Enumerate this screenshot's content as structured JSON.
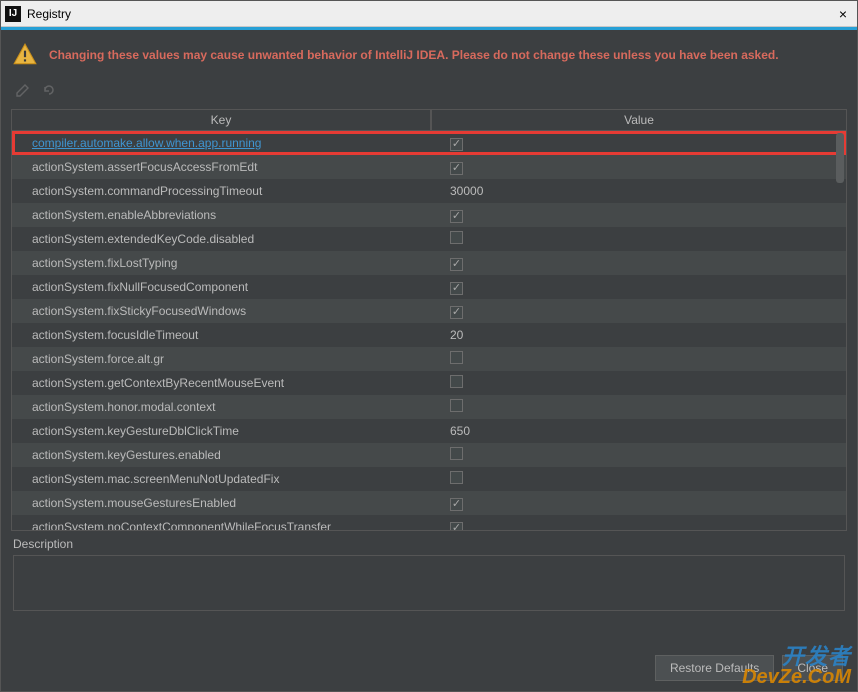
{
  "window": {
    "title": "Registry",
    "close_label": "×"
  },
  "warning": {
    "text": "Changing these values may cause unwanted behavior of IntelliJ IDEA. Please do not change these unless you have been asked."
  },
  "headers": {
    "key": "Key",
    "value": "Value"
  },
  "rows": [
    {
      "key": "compiler.automake.allow.when.app.running",
      "type": "bool",
      "checked": true,
      "highlighted": true
    },
    {
      "key": "actionSystem.assertFocusAccessFromEdt",
      "type": "bool",
      "checked": true
    },
    {
      "key": "actionSystem.commandProcessingTimeout",
      "type": "text",
      "value": "30000"
    },
    {
      "key": "actionSystem.enableAbbreviations",
      "type": "bool",
      "checked": true
    },
    {
      "key": "actionSystem.extendedKeyCode.disabled",
      "type": "bool",
      "checked": false
    },
    {
      "key": "actionSystem.fixLostTyping",
      "type": "bool",
      "checked": true
    },
    {
      "key": "actionSystem.fixNullFocusedComponent",
      "type": "bool",
      "checked": true
    },
    {
      "key": "actionSystem.fixStickyFocusedWindows",
      "type": "bool",
      "checked": true
    },
    {
      "key": "actionSystem.focusIdleTimeout",
      "type": "text",
      "value": "20"
    },
    {
      "key": "actionSystem.force.alt.gr",
      "type": "bool",
      "checked": false
    },
    {
      "key": "actionSystem.getContextByRecentMouseEvent",
      "type": "bool",
      "checked": false
    },
    {
      "key": "actionSystem.honor.modal.context",
      "type": "bool",
      "checked": false
    },
    {
      "key": "actionSystem.keyGestureDblClickTime",
      "type": "text",
      "value": "650"
    },
    {
      "key": "actionSystem.keyGestures.enabled",
      "type": "bool",
      "checked": false
    },
    {
      "key": "actionSystem.mac.screenMenuNotUpdatedFix",
      "type": "bool",
      "checked": false
    },
    {
      "key": "actionSystem.mouseGesturesEnabled",
      "type": "bool",
      "checked": true
    },
    {
      "key": "actionSystem.noContextComponentWhileFocusTransfer",
      "type": "bool",
      "checked": true
    }
  ],
  "description": {
    "label": "Description"
  },
  "buttons": {
    "restore": "Restore Defaults",
    "close": "Close"
  },
  "watermark": {
    "line1": "开发者",
    "line2": "DevZe.CoM"
  }
}
